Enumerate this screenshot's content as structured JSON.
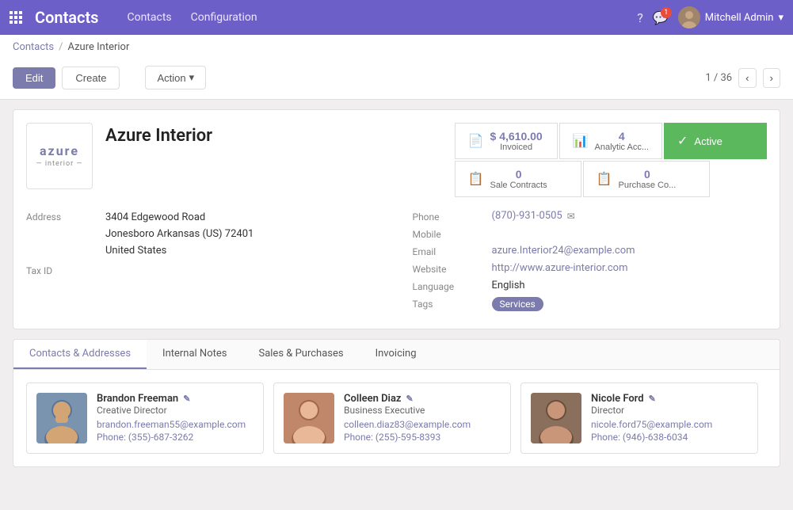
{
  "app": {
    "grid_icon": "⋮⋮⋮",
    "title": "Contacts",
    "nav_links": [
      "Contacts",
      "Configuration"
    ],
    "user_name": "Mitchell Admin",
    "chat_badge": "1"
  },
  "breadcrumb": {
    "parent": "Contacts",
    "separator": "/",
    "current": "Azure Interior"
  },
  "toolbar": {
    "edit_label": "Edit",
    "create_label": "Create",
    "action_label": "Action",
    "pager": "1 / 36"
  },
  "record": {
    "company_name": "Azure Interior",
    "logo_top": "azure",
    "logo_bottom": "— interior —",
    "stats": {
      "invoiced_amount": "$ 4,610.00",
      "invoiced_label": "Invoiced",
      "analytic_count": "4",
      "analytic_label": "Analytic Acc...",
      "active_label": "Active",
      "sale_contracts_count": "0",
      "sale_contracts_label": "Sale Contracts",
      "purchase_count": "0",
      "purchase_label": "Purchase Co..."
    },
    "address_label": "Address",
    "address_line1": "3404 Edgewood Road",
    "address_line2": "Jonesboro  Arkansas (US)  72401",
    "address_line3": "United States",
    "tax_id_label": "Tax ID",
    "tax_id_value": "",
    "phone_label": "Phone",
    "phone_value": "(870)-931-0505",
    "mobile_label": "Mobile",
    "email_label": "Email",
    "email_value": "azure.Interior24@example.com",
    "website_label": "Website",
    "website_value": "http://www.azure-interior.com",
    "language_label": "Language",
    "language_value": "English",
    "tags_label": "Tags",
    "tag_value": "Services"
  },
  "tabs": [
    {
      "id": "contacts",
      "label": "Contacts & Addresses",
      "active": true
    },
    {
      "id": "notes",
      "label": "Internal Notes",
      "active": false
    },
    {
      "id": "sales",
      "label": "Sales & Purchases",
      "active": false
    },
    {
      "id": "invoicing",
      "label": "Invoicing",
      "active": false
    }
  ],
  "contacts": [
    {
      "name": "Brandon Freeman",
      "role": "Creative Director",
      "email": "brandon.freeman55@example.com",
      "phone_label": "Phone:",
      "phone": "(355)-687-3262",
      "avatar_bg": "#7a94b0"
    },
    {
      "name": "Colleen Diaz",
      "role": "Business Executive",
      "email": "colleen.diaz83@example.com",
      "phone_label": "Phone:",
      "phone": "(255)-595-8393",
      "avatar_bg": "#c0876a"
    },
    {
      "name": "Nicole Ford",
      "role": "Director",
      "email": "nicole.ford75@example.com",
      "phone_label": "Phone:",
      "phone": "(946)-638-6034",
      "avatar_bg": "#8a6f5c"
    }
  ]
}
